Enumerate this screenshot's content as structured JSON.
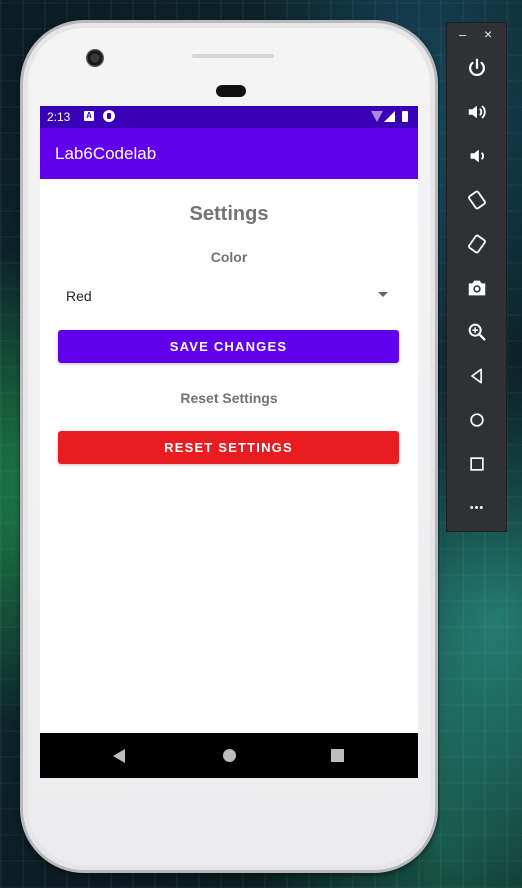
{
  "status_bar": {
    "time": "2:13",
    "icon_a_label": "A"
  },
  "app_bar": {
    "title": "Lab6Codelab"
  },
  "settings": {
    "title": "Settings",
    "color_label": "Color",
    "color_selected": "Red",
    "save_button": "SAVE CHANGES",
    "reset_label": "Reset Settings",
    "reset_button": "RESET SETTINGS"
  },
  "toolbar": {
    "minimize_glyph": "–",
    "close_glyph": "×",
    "items": [
      {
        "icon": "power-icon"
      },
      {
        "icon": "volume-up-icon"
      },
      {
        "icon": "volume-down-icon"
      },
      {
        "icon": "rotate-left-icon"
      },
      {
        "icon": "rotate-right-icon"
      },
      {
        "icon": "camera-icon"
      },
      {
        "icon": "zoom-icon"
      },
      {
        "icon": "back-icon"
      },
      {
        "icon": "home-icon"
      },
      {
        "icon": "overview-icon"
      },
      {
        "icon": "more-icon"
      }
    ],
    "more_glyph": "•••"
  },
  "colors": {
    "primary": "#6200ee",
    "status_bar": "#3a00b8",
    "reset_red": "#eb1c1f"
  }
}
